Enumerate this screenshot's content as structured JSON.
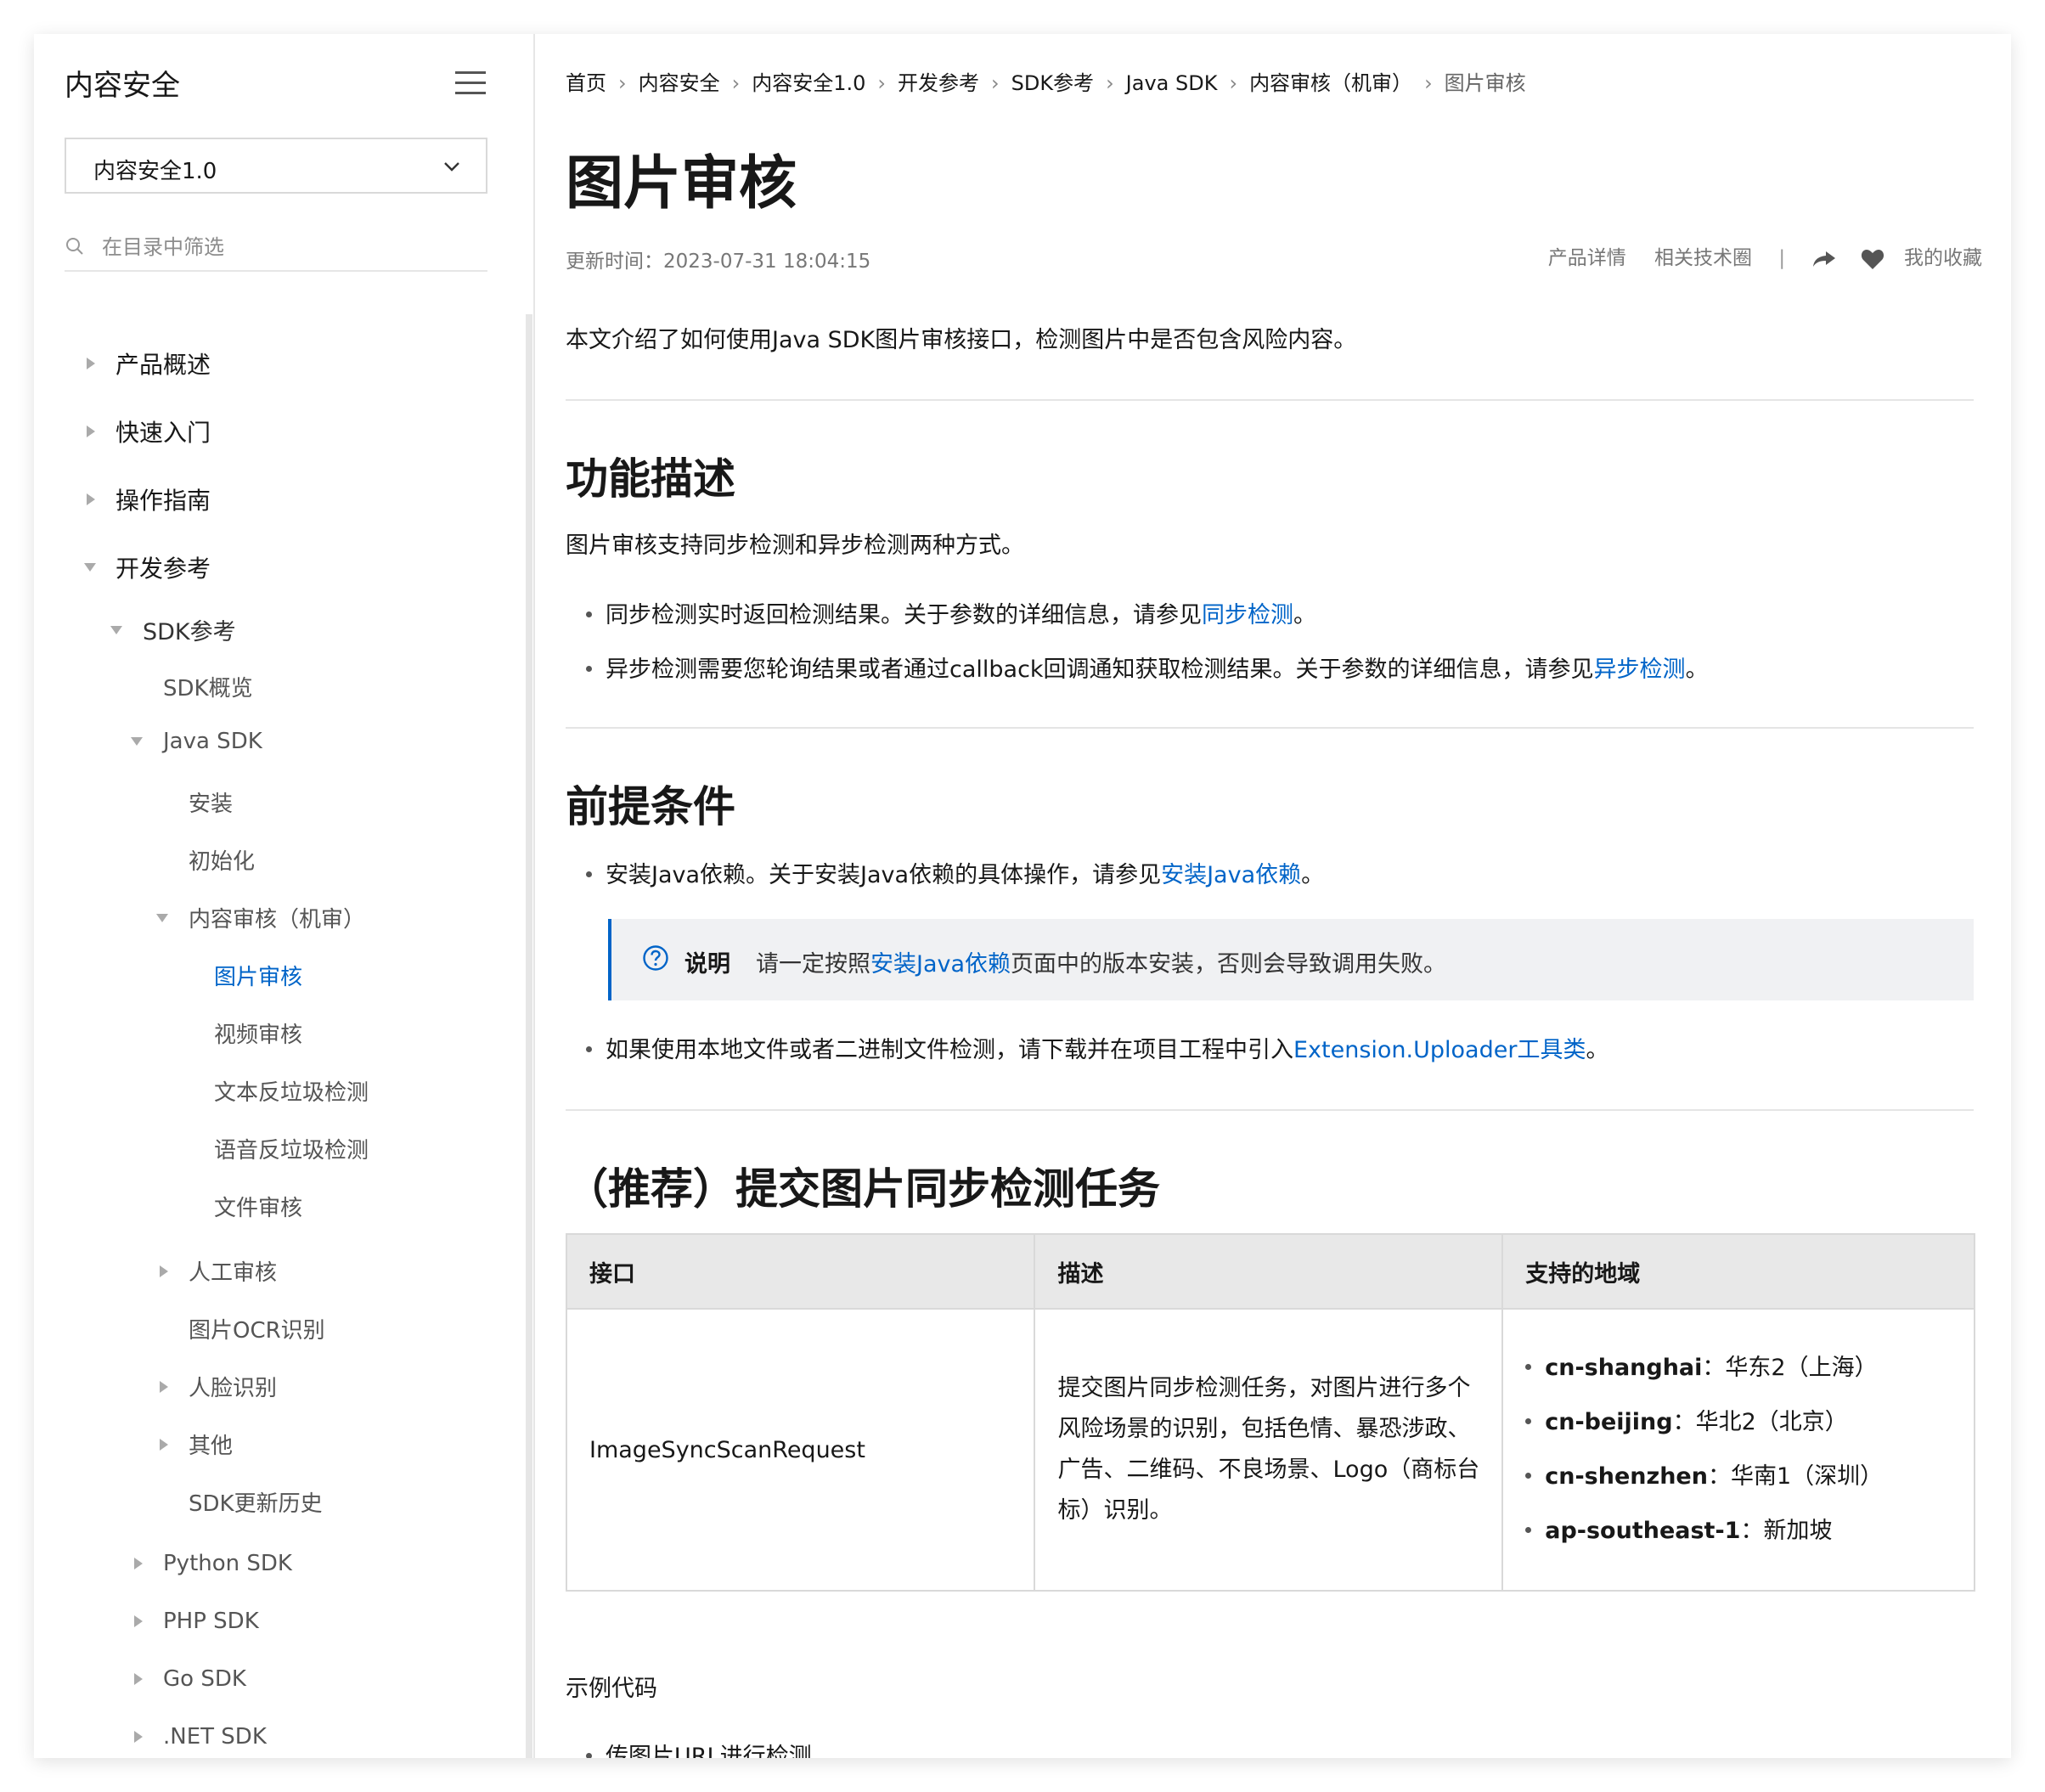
{
  "sidebar": {
    "title": "内容安全",
    "version": "内容安全1.0",
    "filter_placeholder": "在目录中筛选",
    "items": [
      {
        "label": "产品概述"
      },
      {
        "label": "快速入门"
      },
      {
        "label": "操作指南"
      },
      {
        "label": "开发参考"
      },
      {
        "label": "SDK参考"
      },
      {
        "label": "SDK概览"
      },
      {
        "label": "Java SDK"
      },
      {
        "label": "安装"
      },
      {
        "label": "初始化"
      },
      {
        "label": "内容审核（机审）"
      },
      {
        "label": "图片审核"
      },
      {
        "label": "视频审核"
      },
      {
        "label": "文本反垃圾检测"
      },
      {
        "label": "语音反垃圾检测"
      },
      {
        "label": "文件审核"
      },
      {
        "label": "人工审核"
      },
      {
        "label": "图片OCR识别"
      },
      {
        "label": "人脸识别"
      },
      {
        "label": "其他"
      },
      {
        "label": "SDK更新历史"
      },
      {
        "label": "Python SDK"
      },
      {
        "label": "PHP SDK"
      },
      {
        "label": "Go SDK"
      },
      {
        "label": ".NET SDK"
      }
    ]
  },
  "breadcrumb": [
    "首页",
    "内容安全",
    "内容安全1.0",
    "开发参考",
    "SDK参考",
    "Java SDK",
    "内容审核（机审）",
    "图片审核"
  ],
  "page": {
    "title": "图片审核",
    "updated": "更新时间：2023-07-31 18:04:15",
    "actions": {
      "product": "产品详情",
      "circle": "相关技术圈",
      "favorite": "我的收藏"
    },
    "intro": "本文介绍了如何使用Java SDK图片审核接口，检测图片中是否包含风险内容。"
  },
  "section1": {
    "heading": "功能描述",
    "text": "图片审核支持同步检测和异步检测两种方式。",
    "bullet1": {
      "text": "同步检测实时返回检测结果。关于参数的详细信息，请参见",
      "link": "同步检测",
      "end": "。"
    },
    "bullet2": {
      "text": "异步检测需要您轮询结果或者通过callback回调通知获取检测结果。关于参数的详细信息，请参见",
      "link": "异步检测",
      "end": "。"
    }
  },
  "section2": {
    "heading": "前提条件",
    "bullet1": {
      "text": "安装Java依赖。关于安装Java依赖的具体操作，请参见",
      "link": "安装Java依赖",
      "end": "。"
    },
    "note": {
      "label": "说明",
      "pre": "请一定按照",
      "link": "安装Java依赖",
      "post": "页面中的版本安装，否则会导致调用失败。"
    },
    "bullet2": {
      "text": "如果使用本地文件或者二进制文件检测，请下载并在项目工程中引入",
      "link": "Extension.Uploader工具类",
      "end": "。"
    }
  },
  "section3": {
    "heading": "（推荐）提交图片同步检测任务",
    "table": {
      "headers": [
        "接口",
        "描述",
        "支持的地域"
      ],
      "api": "ImageSyncScanRequest",
      "desc": "提交图片同步检测任务，对图片进行多个风险场景的识别，包括色情、暴恐涉政、广告、二维码、不良场景、Logo（商标台标）识别。",
      "regions": [
        {
          "id": "cn-shanghai",
          "name": "：华东2（上海）"
        },
        {
          "id": "cn-beijing",
          "name": "：华北2（北京）"
        },
        {
          "id": "cn-shenzhen",
          "name": "：华南1（深圳）"
        },
        {
          "id": "ap-southeast-1",
          "name": "：新加坡"
        }
      ]
    },
    "sample_label": "示例代码",
    "sample_bullet": "传图片URL进行检测"
  },
  "colors": {
    "link": "#0064c8",
    "text": "#181818",
    "table_header": "#e8e8e8",
    "note_bg": "#f0f1f3"
  }
}
